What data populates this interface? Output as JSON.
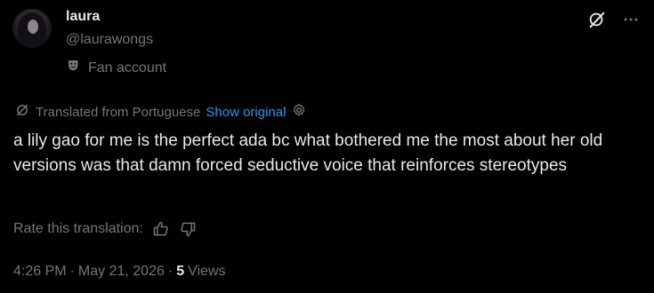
{
  "user": {
    "name": "laura",
    "handle": "@laurawongs",
    "label": "Fan account"
  },
  "translation": {
    "notice": "Translated from Portuguese",
    "show_original": "Show original"
  },
  "tweet": {
    "text": "a lily gao for me is the perfect ada bc what bothered me the most about her old versions was that damn forced seductive voice that reinforces stereotypes"
  },
  "rate": {
    "label": "Rate this translation:"
  },
  "meta": {
    "time": "4:26 PM",
    "sep1": "·",
    "date": "May 21, 2026",
    "sep2": "·",
    "views_count": "5",
    "views_label": "Views"
  },
  "colors": {
    "background": "#000000",
    "text": "#e7e9ea",
    "muted": "#71767b",
    "link": "#1d9bf0"
  },
  "icons": {
    "top_left_action": "grok-icon",
    "top_right_action": "more-icon",
    "label_icon": "theater-masks-icon",
    "translate_icon": "translate-icon",
    "settings_icon": "gear-icon",
    "thumbs_up": "thumbs-up-icon",
    "thumbs_down": "thumbs-down-icon"
  }
}
